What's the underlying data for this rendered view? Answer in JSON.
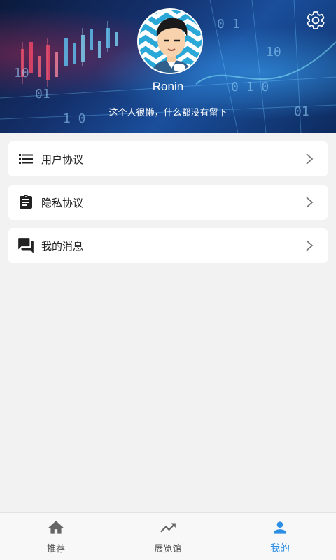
{
  "profile": {
    "username": "Ronin",
    "bio": "这个人很懒，什么都没有留下"
  },
  "menu": [
    {
      "label": "用户协议",
      "icon": "list-icon"
    },
    {
      "label": "隐私协议",
      "icon": "clipboard-icon"
    },
    {
      "label": "我的消息",
      "icon": "chat-icon"
    }
  ],
  "nav": [
    {
      "label": "推荐",
      "icon": "home-icon",
      "active": false
    },
    {
      "label": "展览馆",
      "icon": "trending-icon",
      "active": false
    },
    {
      "label": "我的",
      "icon": "person-icon",
      "active": true
    }
  ],
  "colors": {
    "accent": "#2d8ee6",
    "icon_dark": "#222222",
    "nav_icon": "#666666",
    "background": "#f2f2f2"
  }
}
